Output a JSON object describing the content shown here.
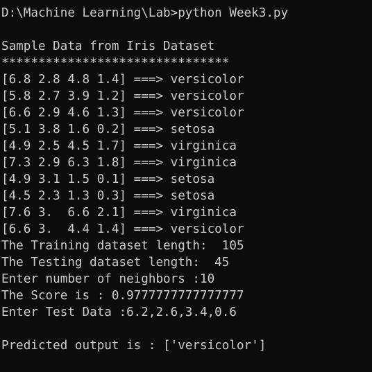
{
  "terminal": {
    "lines": [
      "D:\\Machine Learning\\Lab>python Week3.py",
      "",
      "Sample Data from Iris Dataset",
      "*******************************",
      "[6.8 2.8 4.8 1.4] ===> versicolor",
      "[5.8 2.7 3.9 1.2] ===> versicolor",
      "[6.6 2.9 4.6 1.3] ===> versicolor",
      "[5.1 3.8 1.6 0.2] ===> setosa",
      "[4.9 2.5 4.5 1.7] ===> virginica",
      "[7.3 2.9 6.3 1.8] ===> virginica",
      "[4.9 3.1 1.5 0.1] ===> setosa",
      "[4.5 2.3 1.3 0.3] ===> setosa",
      "[7.6 3.  6.6 2.1] ===> virginica",
      "[6.6 3.  4.4 1.4] ===> versicolor",
      "The Training dataset length:  105",
      "The Testing dataset length:  45",
      "Enter number of neighbors :10",
      "The Score is : 0.9777777777777777",
      "Enter Test Data :6.2,2.6,3.4,0.6",
      "",
      "Predicted output is : ['versicolor']"
    ]
  }
}
